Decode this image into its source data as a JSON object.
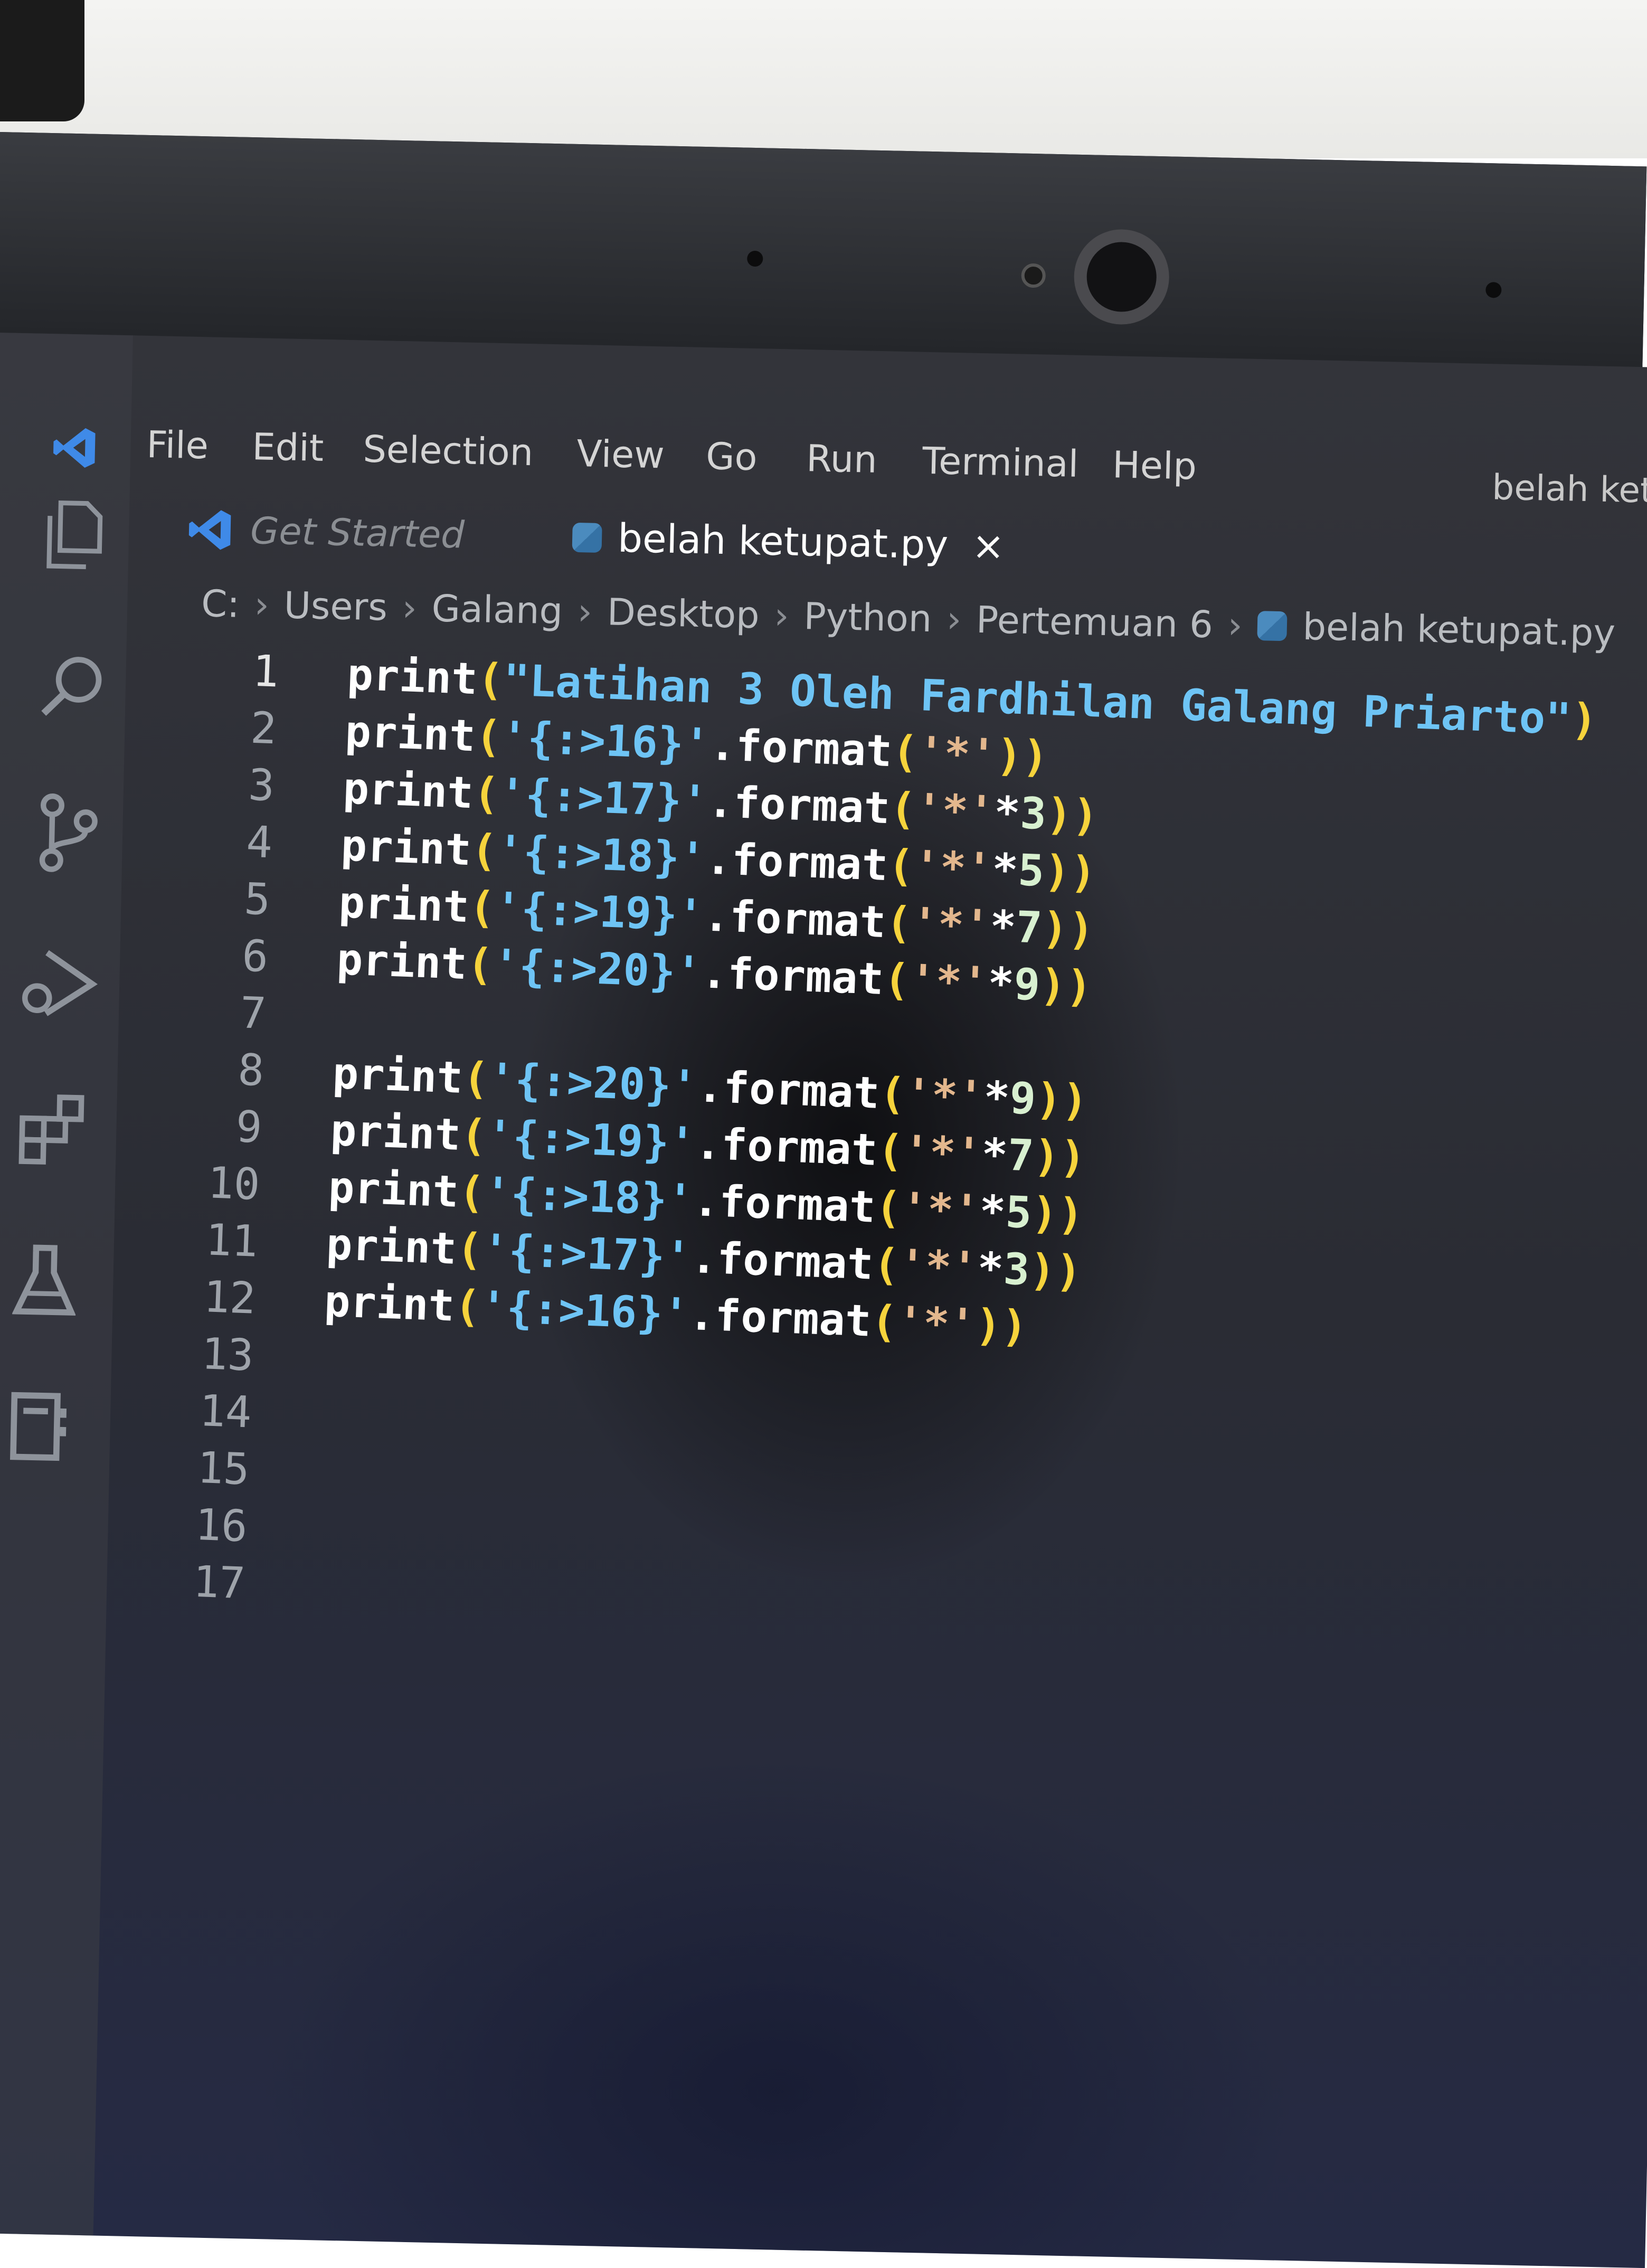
{
  "menu": {
    "items": [
      "File",
      "Edit",
      "Selection",
      "View",
      "Go",
      "Run",
      "Terminal",
      "Help"
    ]
  },
  "window_title": "belah ket",
  "tabs": [
    {
      "label": "Get Started",
      "active": false
    },
    {
      "label": "belah ketupat.py",
      "active": true,
      "close_glyph": "×"
    }
  ],
  "breadcrumb": [
    "C:",
    "Users",
    "Galang",
    "Desktop",
    "Python",
    "Pertemuan 6",
    "belah ketupat.py"
  ],
  "editor": {
    "line_numbers": [
      "1",
      "2",
      "3",
      "4",
      "5",
      "6",
      "7",
      "8",
      "9",
      "10",
      "11",
      "12",
      "13",
      "14",
      "15",
      "16",
      "17"
    ],
    "lines": [
      "print(\"Latihan 3 Oleh Fardhilan Galang Priarto\")",
      "print('{:>16}'.format('*'))",
      "print('{:>17}'.format('*'*3))",
      "print('{:>18}'.format('*'*5))",
      "print('{:>19}'.format('*'*7))",
      "print('{:>20}'.format('*'*9))",
      "",
      "print('{:>20}'.format('*'*9))",
      "print('{:>19}'.format('*'*7))",
      "print('{:>18}'.format('*'*5))",
      "print('{:>17}'.format('*'*3))",
      "print('{:>16}'.format('*'))",
      "",
      "",
      "",
      "",
      ""
    ]
  },
  "activity_icons": [
    "explorer-icon",
    "search-icon",
    "source-control-icon",
    "run-debug-icon",
    "extensions-icon",
    "testing-icon",
    "notebook-icon"
  ],
  "colors": {
    "editor_bg": "#2b2d33",
    "string": "#6ec4f5",
    "paren": "#f6d33c",
    "keyword": "#ffffff"
  }
}
